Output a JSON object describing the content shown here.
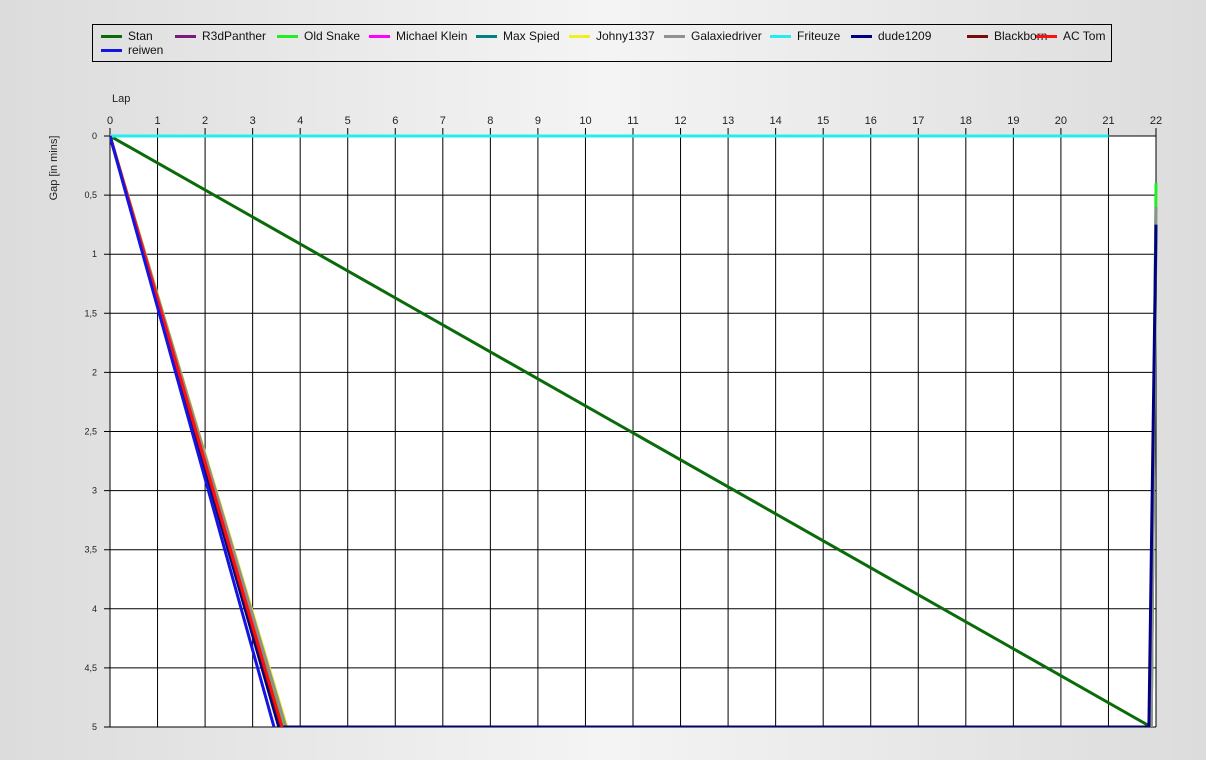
{
  "chart_data": {
    "type": "line",
    "xlabel": "Lap",
    "ylabel": "Gap [in mins]",
    "x_ticks": [
      0,
      1,
      2,
      3,
      4,
      5,
      6,
      7,
      8,
      9,
      10,
      11,
      12,
      13,
      14,
      15,
      16,
      17,
      18,
      19,
      20,
      21,
      22
    ],
    "y_ticks": [
      "0",
      "0,5",
      "1",
      "1,5",
      "2",
      "2,5",
      "3",
      "3,5",
      "4",
      "4,5",
      "5"
    ],
    "xlim": [
      0,
      22
    ],
    "ylim": [
      0,
      5
    ],
    "y_inverted": true,
    "grid": true,
    "legend_position": "top",
    "series": [
      {
        "name": "Stan",
        "color": "#0a6b0a",
        "points": [
          [
            0,
            0
          ],
          [
            21.9,
            5
          ],
          [
            22,
            0.75
          ]
        ]
      },
      {
        "name": "R3dPanther",
        "color": "#7a1a7a",
        "points": [
          [
            0,
            0
          ],
          [
            3.65,
            5
          ]
        ]
      },
      {
        "name": "Old Snake",
        "color": "#22ee22",
        "points": [
          [
            0,
            0
          ],
          [
            3.65,
            5
          ],
          [
            21.9,
            5
          ],
          [
            22,
            0.4
          ]
        ]
      },
      {
        "name": "Michael Klein",
        "color": "#ff00ff",
        "points": [
          [
            0,
            0
          ],
          [
            3.6,
            5
          ]
        ]
      },
      {
        "name": "Max Spied",
        "color": "#008080",
        "points": [
          [
            0,
            0
          ],
          [
            3.6,
            5
          ]
        ]
      },
      {
        "name": "Johny1337",
        "color": "#f0f020",
        "points": [
          [
            0,
            0
          ],
          [
            3.72,
            5
          ]
        ]
      },
      {
        "name": "Galaxiedriver",
        "color": "#909090",
        "points": [
          [
            0,
            0
          ],
          [
            3.7,
            5
          ],
          [
            21.9,
            5
          ],
          [
            22,
            0.6
          ]
        ]
      },
      {
        "name": "Friteuze",
        "color": "#22eeee",
        "points": [
          [
            0,
            0
          ],
          [
            21,
            0
          ]
        ]
      },
      {
        "name": "dude1209",
        "color": "#000080",
        "points": [
          [
            0,
            0
          ],
          [
            3.55,
            5
          ],
          [
            21.85,
            5
          ],
          [
            22,
            0.75
          ]
        ]
      },
      {
        "name": "Blackborn",
        "color": "#7a0a0a",
        "points": [
          [
            0,
            0
          ],
          [
            3.6,
            5
          ]
        ]
      },
      {
        "name": "AC Tom",
        "color": "#ff1010",
        "points": [
          [
            0,
            0
          ],
          [
            3.62,
            5
          ]
        ]
      },
      {
        "name": "reiwen",
        "color": "#1515e0",
        "points": [
          [
            0,
            0
          ],
          [
            3.45,
            5
          ]
        ]
      }
    ]
  }
}
